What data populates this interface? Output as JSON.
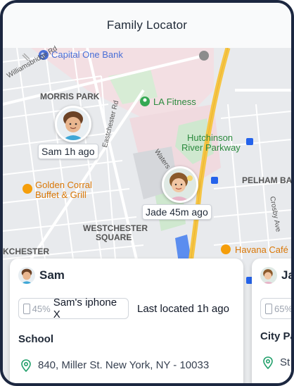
{
  "app": {
    "title": "Family Locator"
  },
  "map": {
    "labels": {
      "capital_one": "Capital One Bank",
      "morris_park": "MORRIS PARK",
      "la_fitness": "LA Fitness",
      "hutchinson_1": "Hutchinson",
      "hutchinson_2": "River Parkway",
      "eastchester": "Eastchester Rd",
      "waters": "Waters Pl",
      "golden_corral_1": "Golden Corral",
      "golden_corral_2": "Buffet & Grill",
      "pelham": "PELHAM BA",
      "westchester_1": "WESTCHESTER",
      "westchester_2": "SQUARE",
      "chester": "KCHESTER",
      "havana": "Havana Café",
      "crosby": "Crosby Ave",
      "williamsbridge": "Williamsbridge Rd"
    },
    "markers": [
      {
        "name": "Sam",
        "time": "1h ago",
        "text": "Sam 1h ago"
      },
      {
        "name": "Jade",
        "time": "45m ago",
        "text": "Jade 45m ago"
      }
    ],
    "colors": {
      "water": "#3b82f6",
      "highway": "#f6c544",
      "park": "#cfe8cf",
      "poi_green": "#34a853",
      "poi_orange": "#f59e0b"
    }
  },
  "cards": [
    {
      "name": "Sam",
      "battery": "45%",
      "device": "Sam's iphone X",
      "last_located": "Last located 1h ago",
      "place": "School",
      "address": "840, Miller St. New York, NY - 10033"
    },
    {
      "name": "Ja",
      "battery": "65%",
      "place": "City Pa",
      "address": "St"
    }
  ]
}
